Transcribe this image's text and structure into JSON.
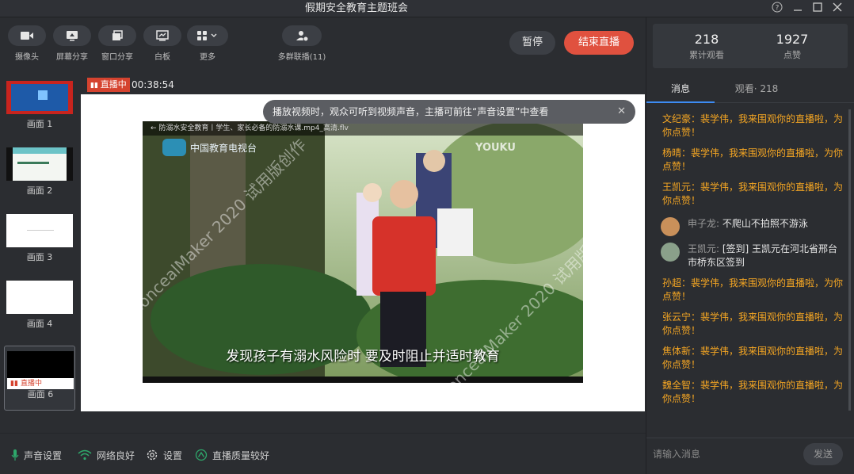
{
  "window": {
    "title": "假期安全教育主题班会"
  },
  "toolbar": {
    "camera": "摄像头",
    "screen_share": "屏幕分享",
    "window_share": "窗口分享",
    "whiteboard": "白板",
    "more": "更多",
    "multi_group": "多群联播(11)",
    "pause": "暂停",
    "end_live": "结束直播"
  },
  "scenes": [
    {
      "name": "画面 1"
    },
    {
      "name": "画面 2"
    },
    {
      "name": "画面 3"
    },
    {
      "name": "画面 4"
    },
    {
      "name": "画面 6",
      "badge": "直播中"
    }
  ],
  "stage": {
    "live_tag": "直播中",
    "live_time": "00:38:54",
    "toast": "播放视频时，观众可听到视频声音，主播可前往“声音设置”中查看",
    "video_title": "防溺水安全教育丨学生、家长必备的防溺水课.mp4_高清.flv",
    "video_logo": "YOUKU",
    "subtitle": "发现孩子有溺水风险时 要及时阻止并适时教育",
    "watermark": "ConcealMaker 2020 试用版创作"
  },
  "status": {
    "sound": "声音设置",
    "network": "网络良好",
    "settings": "设置",
    "quality": "直播质量较好"
  },
  "stats": {
    "views": "218",
    "views_label": "累计观看",
    "likes": "1927",
    "likes_label": "点赞"
  },
  "tabs": {
    "messages": "消息",
    "viewers": "观看· 218"
  },
  "messages": [
    {
      "type": "like",
      "text": "文纪豪：裴学伟，我来围观你的直播啦，为你点赞！"
    },
    {
      "type": "like",
      "text": "杨晴：裴学伟，我来围观你的直播啦，为你点赞！"
    },
    {
      "type": "like",
      "text": "王凯元：裴学伟，我来围观你的直播啦，为你点赞！"
    },
    {
      "type": "chat",
      "user": "申子龙:",
      "text": " 不爬山不拍照不游泳"
    },
    {
      "type": "chat",
      "user": "王凯元:",
      "text": " [签到] 王凯元在河北省邢台市桥东区签到"
    },
    {
      "type": "like",
      "text": "孙超：裴学伟，我来围观你的直播啦，为你点赞！"
    },
    {
      "type": "like",
      "text": "张云宁：裴学伟，我来围观你的直播啦，为你点赞！"
    },
    {
      "type": "like",
      "text": "焦体新：裴学伟，我来围观你的直播啦，为你点赞！"
    },
    {
      "type": "like",
      "text": "魏全智：裴学伟，我来围观你的直播啦，为你点赞！"
    }
  ],
  "chat_input": {
    "placeholder": "请输入消息",
    "send": "发送"
  },
  "colors": {
    "accent": "#3d8bf2",
    "end_button": "#e0513f",
    "like_text": "#f5a623",
    "live_red": "#d5432f"
  }
}
